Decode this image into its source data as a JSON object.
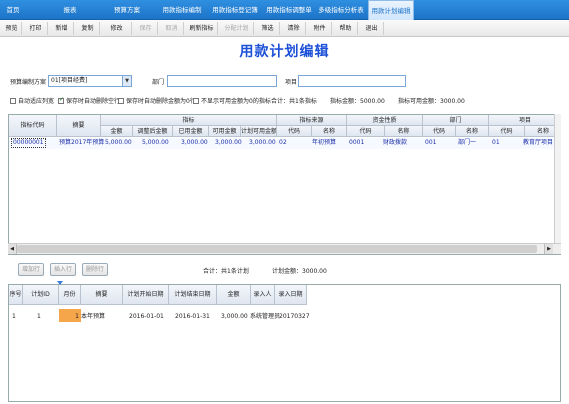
{
  "nav": {
    "items": [
      "首页",
      "报表",
      "预算方案",
      "用款指标编制",
      "用款指标登记簿",
      "用款指标调整单",
      "多级指标分析表",
      "用款计划编辑"
    ],
    "active_index": 7
  },
  "toolbar": {
    "items": [
      "预览",
      "打印",
      "新增",
      "复制",
      "修改",
      "保存",
      "取消",
      "刷新指标",
      "分配计划",
      "筛选",
      "清除",
      "附件",
      "帮助",
      "退出"
    ],
    "disabled": [
      "保存",
      "取消",
      "分配计划"
    ]
  },
  "page_title": "用款计划编辑",
  "form": {
    "budget_plan_label": "预算编制方案",
    "budget_plan_value": "01[项目经费]",
    "dept_label": "部门",
    "dept_value": "",
    "project_label": "项目",
    "project_value": ""
  },
  "options": {
    "auto_fit_cols": "自动适应列宽",
    "auto_delete_empty": "保存时自动删除空行",
    "auto_delete_zero": "保存时自动删除金额为0行",
    "hide_zero_available": "不显示可用金额为0的指标",
    "summary_count": "合计：共1条指标",
    "summary_amount": "指标金额：5000.00",
    "summary_available": "指标可用金额：3000.00"
  },
  "grid": {
    "headers": {
      "code": "指标代码",
      "summary": "摘要",
      "indicator_group": "指标",
      "amount": "金额",
      "adjusted_amount": "调整后金额",
      "used_amount": "已用金额",
      "available_amount": "可用金额",
      "plan_available_amount": "计划可用金额",
      "source_group": "指标来源",
      "src_code": "代码",
      "src_name": "名称",
      "fund_group": "资金性质",
      "fund_code": "代码",
      "fund_name": "名称",
      "dept_group": "部门",
      "dept_code": "代码",
      "dept_name": "名称",
      "proj_group": "项目",
      "proj_code": "代码",
      "proj_name": "名称"
    },
    "rows": [
      {
        "code": "00000001",
        "summary": "预算2017年预算",
        "amount": "5,000.00",
        "adjusted_amount": "5,000.00",
        "used_amount": "3,000.00",
        "available_amount": "3,000.00",
        "plan_available_amount": "3,000.00",
        "src_code": "02",
        "src_name": "年初预算",
        "fund_code": "0001",
        "fund_name": "财政拨款",
        "dept_code": "001",
        "dept_name": "部门一",
        "proj_code": "01",
        "proj_name": "教育厅项目"
      }
    ]
  },
  "lower_toolbar": {
    "add_row": "增加行",
    "insert_row": "插入行",
    "delete_row": "删除行",
    "plan_count": "合计：共1条计划",
    "plan_amount": "计划金额：3000.00"
  },
  "plan_grid": {
    "headers": [
      "序号",
      "计划ID",
      "月份",
      "摘要",
      "计划开始日期",
      "计划结束日期",
      "金额",
      "录入人",
      "录入日期"
    ],
    "rows": [
      [
        "1",
        "1",
        "1",
        "本年预算",
        "2016-01-01",
        "2016-01-31",
        "3,000.00",
        "系统管理员",
        "20170327"
      ]
    ]
  },
  "colors": {
    "nav_blue": "#1d74c8",
    "title_blue": "#1d50d8",
    "month_cell": "#f5a54a"
  }
}
